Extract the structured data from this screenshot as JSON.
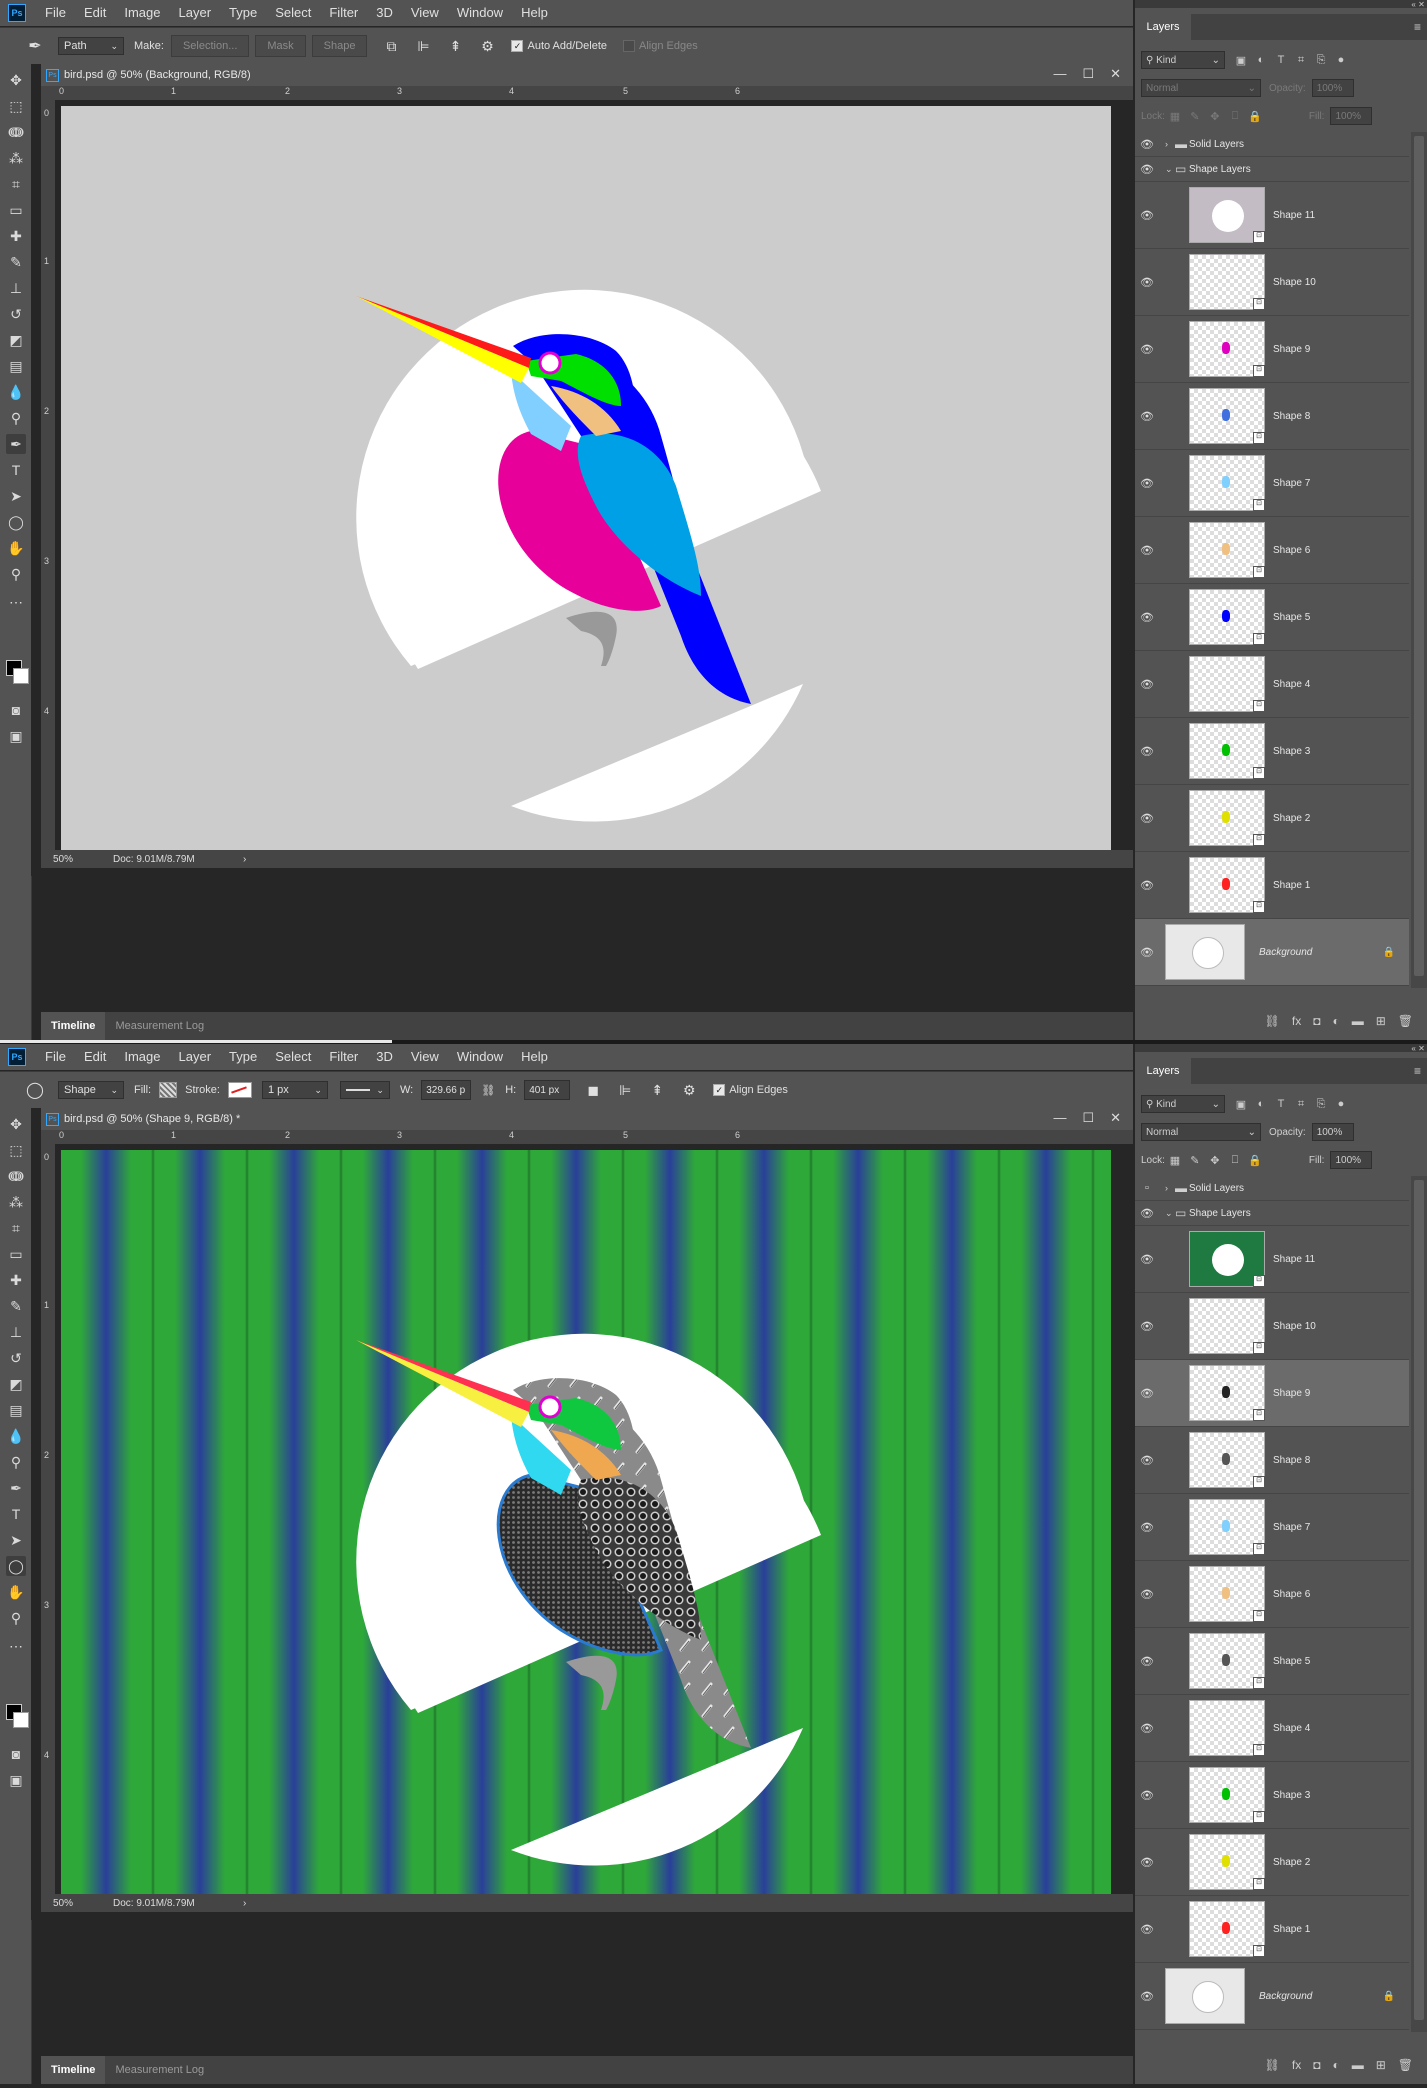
{
  "app": {
    "logo": "Ps"
  },
  "menu": [
    "File",
    "Edit",
    "Image",
    "Layer",
    "Type",
    "Select",
    "Filter",
    "3D",
    "View",
    "Window",
    "Help"
  ],
  "screenA": {
    "options": {
      "tool_icon": "pen-icon",
      "mode": "Path",
      "make_label": "Make:",
      "make_buttons": [
        "Selection...",
        "Mask",
        "Shape"
      ],
      "auto_add_delete": "Auto Add/Delete",
      "align_edges": "Align Edges"
    },
    "doc_title": "bird.psd @ 50% (Background, RGB/8)",
    "zoom": "50%",
    "doc_info": "Doc: 9.01M/8.79M",
    "timeline_tabs": [
      "Timeline",
      "Measurement Log"
    ],
    "layers": {
      "title": "Layers",
      "filter": "Kind",
      "blend_mode": "Normal",
      "opacity_label": "Opacity:",
      "opacity": "100%",
      "lock_label": "Lock:",
      "fill_label": "Fill:",
      "fill": "100%",
      "groups": [
        "Solid Layers",
        "Shape Layers"
      ],
      "items": [
        "Shape 11",
        "Shape 10",
        "Shape 9",
        "Shape 8",
        "Shape 7",
        "Shape 6",
        "Shape 5",
        "Shape 4",
        "Shape 3",
        "Shape 2",
        "Shape 1"
      ],
      "background": "Background"
    }
  },
  "screenB": {
    "options": {
      "tool_icon": "ellipse-icon",
      "mode": "Shape",
      "fill_label": "Fill:",
      "stroke_label": "Stroke:",
      "stroke_width": "1 px",
      "w_label": "W:",
      "w_value": "329.66 p",
      "h_label": "H:",
      "h_value": "401 px",
      "align_edges": "Align Edges"
    },
    "doc_title": "bird.psd @ 50% (Shape 9, RGB/8) *",
    "zoom": "50%",
    "doc_info": "Doc: 9.01M/8.79M",
    "timeline_tabs": [
      "Timeline",
      "Measurement Log"
    ],
    "layers": {
      "title": "Layers",
      "filter": "Kind",
      "blend_mode": "Normal",
      "opacity_label": "Opacity:",
      "opacity": "100%",
      "lock_label": "Lock:",
      "fill_label": "Fill:",
      "fill": "100%",
      "groups": [
        "Solid Layers",
        "Shape Layers"
      ],
      "items": [
        "Shape 11",
        "Shape 10",
        "Shape 9",
        "Shape 8",
        "Shape 7",
        "Shape 6",
        "Shape 5",
        "Shape 4",
        "Shape 3",
        "Shape 2",
        "Shape 1"
      ],
      "selected": "Shape 9",
      "background": "Background"
    }
  },
  "ruler": {
    "h": [
      "0",
      "1",
      "2",
      "3",
      "4",
      "5",
      "6"
    ],
    "v": [
      "0",
      "1",
      "2",
      "3",
      "4"
    ]
  },
  "colors": {
    "chrome": "#535353",
    "canvasA": "#cccccc",
    "stripeGreen": "#2fa83a",
    "stripeBlue": "#2a3f9a",
    "birdBlue": "#0000ff",
    "birdMagenta": "#e8009a",
    "birdCyan": "#00a0e6",
    "birdGreen": "#00e000",
    "beakRed": "#ff1a1a",
    "beakYellow": "#ffff00"
  }
}
